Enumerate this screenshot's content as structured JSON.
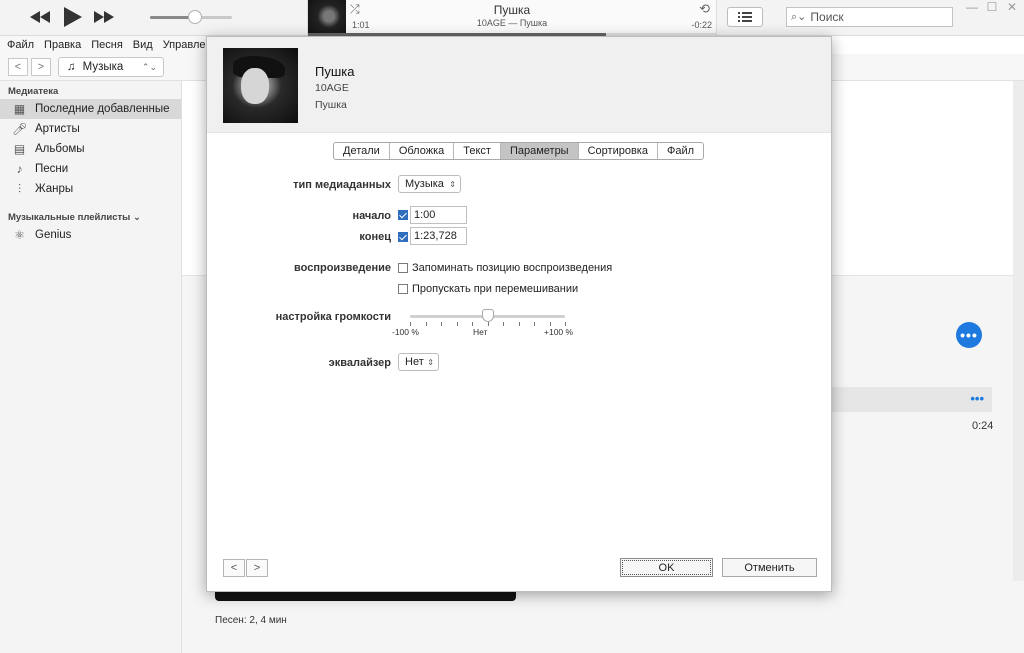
{
  "player": {
    "now_playing_title": "Пушка",
    "now_playing_subtitle": "10AGE — Пушка",
    "elapsed": "1:01",
    "remaining": "-0:22",
    "progress_fraction": 0.73,
    "volume_fraction": 0.55
  },
  "search": {
    "placeholder": "Поиск"
  },
  "menu": {
    "items": [
      "Файл",
      "Правка",
      "Песня",
      "Вид",
      "Управлени"
    ]
  },
  "nav": {
    "media_label": "Музыка"
  },
  "sidebar": {
    "library_header": "Медиатека",
    "items": [
      {
        "label": "Последние добавленные",
        "icon": "grid-icon"
      },
      {
        "label": "Артисты",
        "icon": "microphone-icon"
      },
      {
        "label": "Альбомы",
        "icon": "album-icon"
      },
      {
        "label": "Песни",
        "icon": "note-icon"
      },
      {
        "label": "Жанры",
        "icon": "genres-icon"
      }
    ],
    "playlists_header": "Музыкальные плейлисты",
    "playlist_items": [
      {
        "label": "Genius",
        "icon": "atom-icon"
      }
    ]
  },
  "background": {
    "row_duration": "0:24",
    "status": "Песен: 2, 4 мин"
  },
  "dialog": {
    "title": "Пушка",
    "artist": "10AGE",
    "album": "Пушка",
    "tabs": [
      "Детали",
      "Обложка",
      "Текст",
      "Параметры",
      "Сортировка",
      "Файл"
    ],
    "active_tab": "Параметры",
    "media_type_label": "тип медиаданных",
    "media_type_value": "Музыка",
    "start_label": "начало",
    "start_checked": true,
    "start_value": "1:00",
    "stop_label": "конец",
    "stop_checked": true,
    "stop_value": "1:23,728",
    "playback_label": "воспроизведение",
    "remember_position_label": "Запоминать позицию воспроизведения",
    "remember_position_checked": false,
    "skip_shuffle_label": "Пропускать при перемешивании",
    "skip_shuffle_checked": false,
    "volume_label": "настройка громкости",
    "volume_min_label": "-100 %",
    "volume_mid_label": "Нет",
    "volume_max_label": "+100 %",
    "volume_adjust_fraction": 0.5,
    "eq_label": "эквалайзер",
    "eq_value": "Нет",
    "ok_label": "OK",
    "cancel_label": "Отменить"
  },
  "colors": {
    "accent": "#1f7ae0",
    "checkbox": "#2f6dbd"
  }
}
